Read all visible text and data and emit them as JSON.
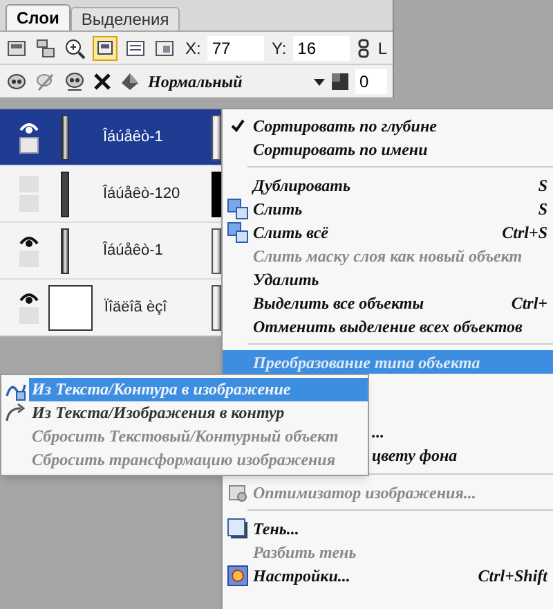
{
  "panel": {
    "tabs": [
      {
        "label": "Слои",
        "selected": true
      },
      {
        "label": "Выделения",
        "selected": false
      }
    ],
    "position": {
      "x_label": "X:",
      "x_value": "77",
      "y_label": "Y:",
      "y_value": "16",
      "cut_label": "L"
    },
    "blend_mode": "Нормальный",
    "opacity": "0"
  },
  "layers": [
    {
      "name": "Îáúåêò-1",
      "visible": true,
      "selected": true
    },
    {
      "name": "Îáúåêò-120",
      "visible": false,
      "selected": false
    },
    {
      "name": "Îáúåêò-1",
      "visible": true,
      "selected": false
    },
    {
      "name": "Ïîäëîã èçî",
      "visible": true,
      "selected": false
    }
  ],
  "context_menu": {
    "items": [
      {
        "kind": "item",
        "label": "Сортировать по глубине",
        "checked": true
      },
      {
        "kind": "item",
        "label": "Сортировать по имени",
        "checked": false
      },
      {
        "kind": "separator"
      },
      {
        "kind": "item",
        "label": "Дублировать",
        "shortcut": "S"
      },
      {
        "kind": "item",
        "label": "Слить",
        "shortcut": "S"
      },
      {
        "kind": "item",
        "label": "Слить всё",
        "shortcut": "Ctrl+S"
      },
      {
        "kind": "item",
        "label": "Слить маску слоя как новый объект",
        "disabled": true
      },
      {
        "kind": "item",
        "label": "Удалить"
      },
      {
        "kind": "item",
        "label": "Выделить все объекты",
        "shortcut": "Ctrl+"
      },
      {
        "kind": "item",
        "label": "Отменить выделение всех объектов"
      },
      {
        "kind": "separator"
      },
      {
        "kind": "item",
        "label": "Преобразование типа объекта",
        "highlighted": true
      },
      {
        "kind": "partial",
        "label": "..."
      },
      {
        "kind": "partial",
        "label": "цвету фона"
      },
      {
        "kind": "separator"
      },
      {
        "kind": "item",
        "label": "Оптимизатор изображения...",
        "disabled": true
      },
      {
        "kind": "separator"
      },
      {
        "kind": "item",
        "label": "Тень..."
      },
      {
        "kind": "item",
        "label": "Разбить тень",
        "disabled": true
      },
      {
        "kind": "item",
        "label": "Настройки...",
        "shortcut": "Ctrl+Shift"
      }
    ]
  },
  "submenu": {
    "items": [
      {
        "label": "Из Текста/Контура в изображение",
        "highlighted": true,
        "disabled": false
      },
      {
        "label": "Из Текста/Изображения в контур",
        "highlighted": false,
        "disabled": false
      },
      {
        "label": "Сбросить Текстовый/Контурный объект",
        "highlighted": false,
        "disabled": true
      },
      {
        "label": "Сбросить трансформацию изображения",
        "highlighted": false,
        "disabled": true
      }
    ]
  }
}
